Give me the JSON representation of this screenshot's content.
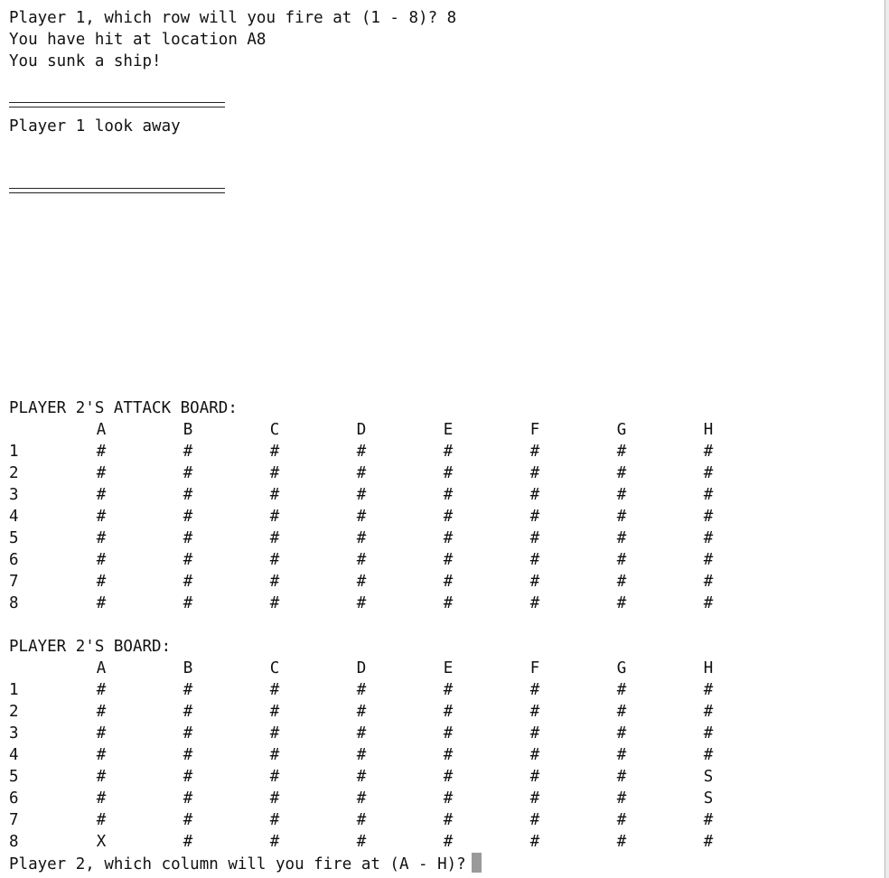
{
  "log": {
    "line1": "Player 1, which row will you fire at (1 - 8)? 8",
    "line2": "You have hit at location A8",
    "line3": "You sunk a ship!",
    "look_away": "Player 1 look away"
  },
  "columns": [
    "A",
    "B",
    "C",
    "D",
    "E",
    "F",
    "G",
    "H"
  ],
  "row_labels": [
    "1",
    "2",
    "3",
    "4",
    "5",
    "6",
    "7",
    "8"
  ],
  "attack_board": {
    "title": "PLAYER 2'S ATTACK BOARD:",
    "rows": [
      [
        "#",
        "#",
        "#",
        "#",
        "#",
        "#",
        "#",
        "#"
      ],
      [
        "#",
        "#",
        "#",
        "#",
        "#",
        "#",
        "#",
        "#"
      ],
      [
        "#",
        "#",
        "#",
        "#",
        "#",
        "#",
        "#",
        "#"
      ],
      [
        "#",
        "#",
        "#",
        "#",
        "#",
        "#",
        "#",
        "#"
      ],
      [
        "#",
        "#",
        "#",
        "#",
        "#",
        "#",
        "#",
        "#"
      ],
      [
        "#",
        "#",
        "#",
        "#",
        "#",
        "#",
        "#",
        "#"
      ],
      [
        "#",
        "#",
        "#",
        "#",
        "#",
        "#",
        "#",
        "#"
      ],
      [
        "#",
        "#",
        "#",
        "#",
        "#",
        "#",
        "#",
        "#"
      ]
    ]
  },
  "own_board": {
    "title": "PLAYER 2'S BOARD:",
    "rows": [
      [
        "#",
        "#",
        "#",
        "#",
        "#",
        "#",
        "#",
        "#"
      ],
      [
        "#",
        "#",
        "#",
        "#",
        "#",
        "#",
        "#",
        "#"
      ],
      [
        "#",
        "#",
        "#",
        "#",
        "#",
        "#",
        "#",
        "#"
      ],
      [
        "#",
        "#",
        "#",
        "#",
        "#",
        "#",
        "#",
        "#"
      ],
      [
        "#",
        "#",
        "#",
        "#",
        "#",
        "#",
        "#",
        "S"
      ],
      [
        "#",
        "#",
        "#",
        "#",
        "#",
        "#",
        "#",
        "S"
      ],
      [
        "#",
        "#",
        "#",
        "#",
        "#",
        "#",
        "#",
        "#"
      ],
      [
        "X",
        "#",
        "#",
        "#",
        "#",
        "#",
        "#",
        "#"
      ]
    ]
  },
  "prompt": {
    "text": "Player 2, which column will you fire at (A - H)?"
  }
}
